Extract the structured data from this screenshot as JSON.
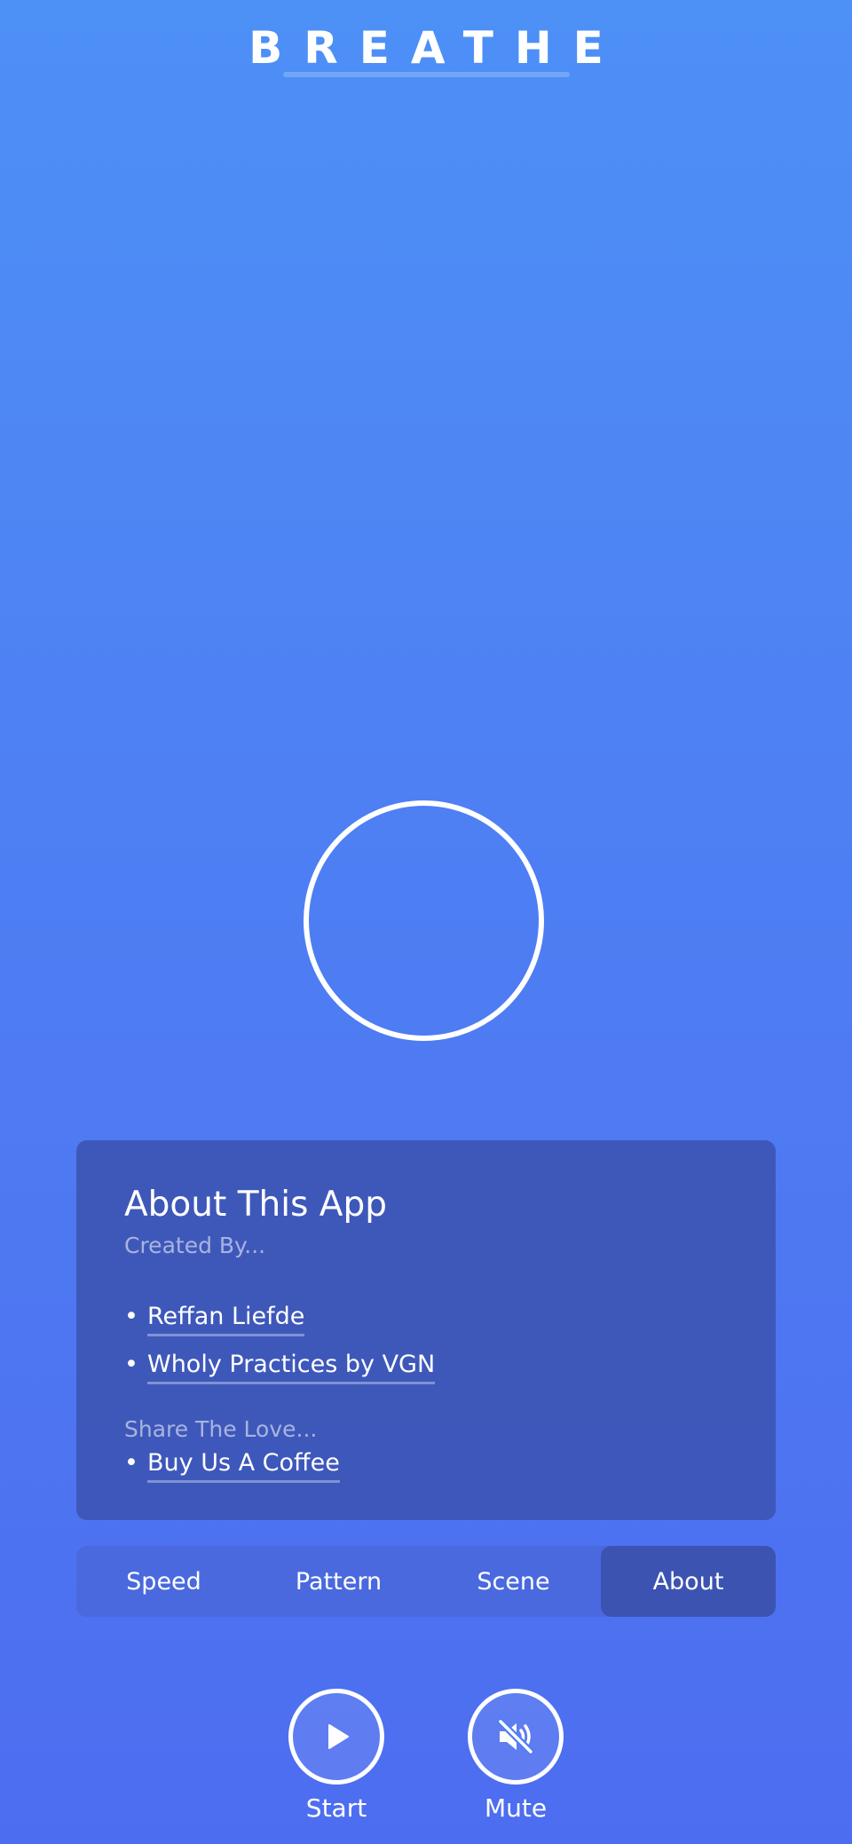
{
  "app": {
    "title": "BREATHE"
  },
  "about": {
    "title": "About This App",
    "created_by_label": "Created By...",
    "credits": [
      {
        "label": "Reffan Liefde"
      },
      {
        "label": "Wholy Practices by VGN"
      }
    ],
    "share_label": "Share The Love...",
    "share_links": [
      {
        "label": "Buy Us A Coffee"
      }
    ]
  },
  "tabs": [
    {
      "label": "Speed",
      "active": false
    },
    {
      "label": "Pattern",
      "active": false
    },
    {
      "label": "Scene",
      "active": false
    },
    {
      "label": "About",
      "active": true
    }
  ],
  "controls": {
    "start": {
      "label": "Start",
      "icon": "play-icon"
    },
    "mute": {
      "label": "Mute",
      "icon": "speaker-muted-icon"
    }
  },
  "colors": {
    "background_top": "#4d90f6",
    "background_bottom": "#4d6df0",
    "panel": "#3a50aa",
    "text": "#ffffff"
  }
}
